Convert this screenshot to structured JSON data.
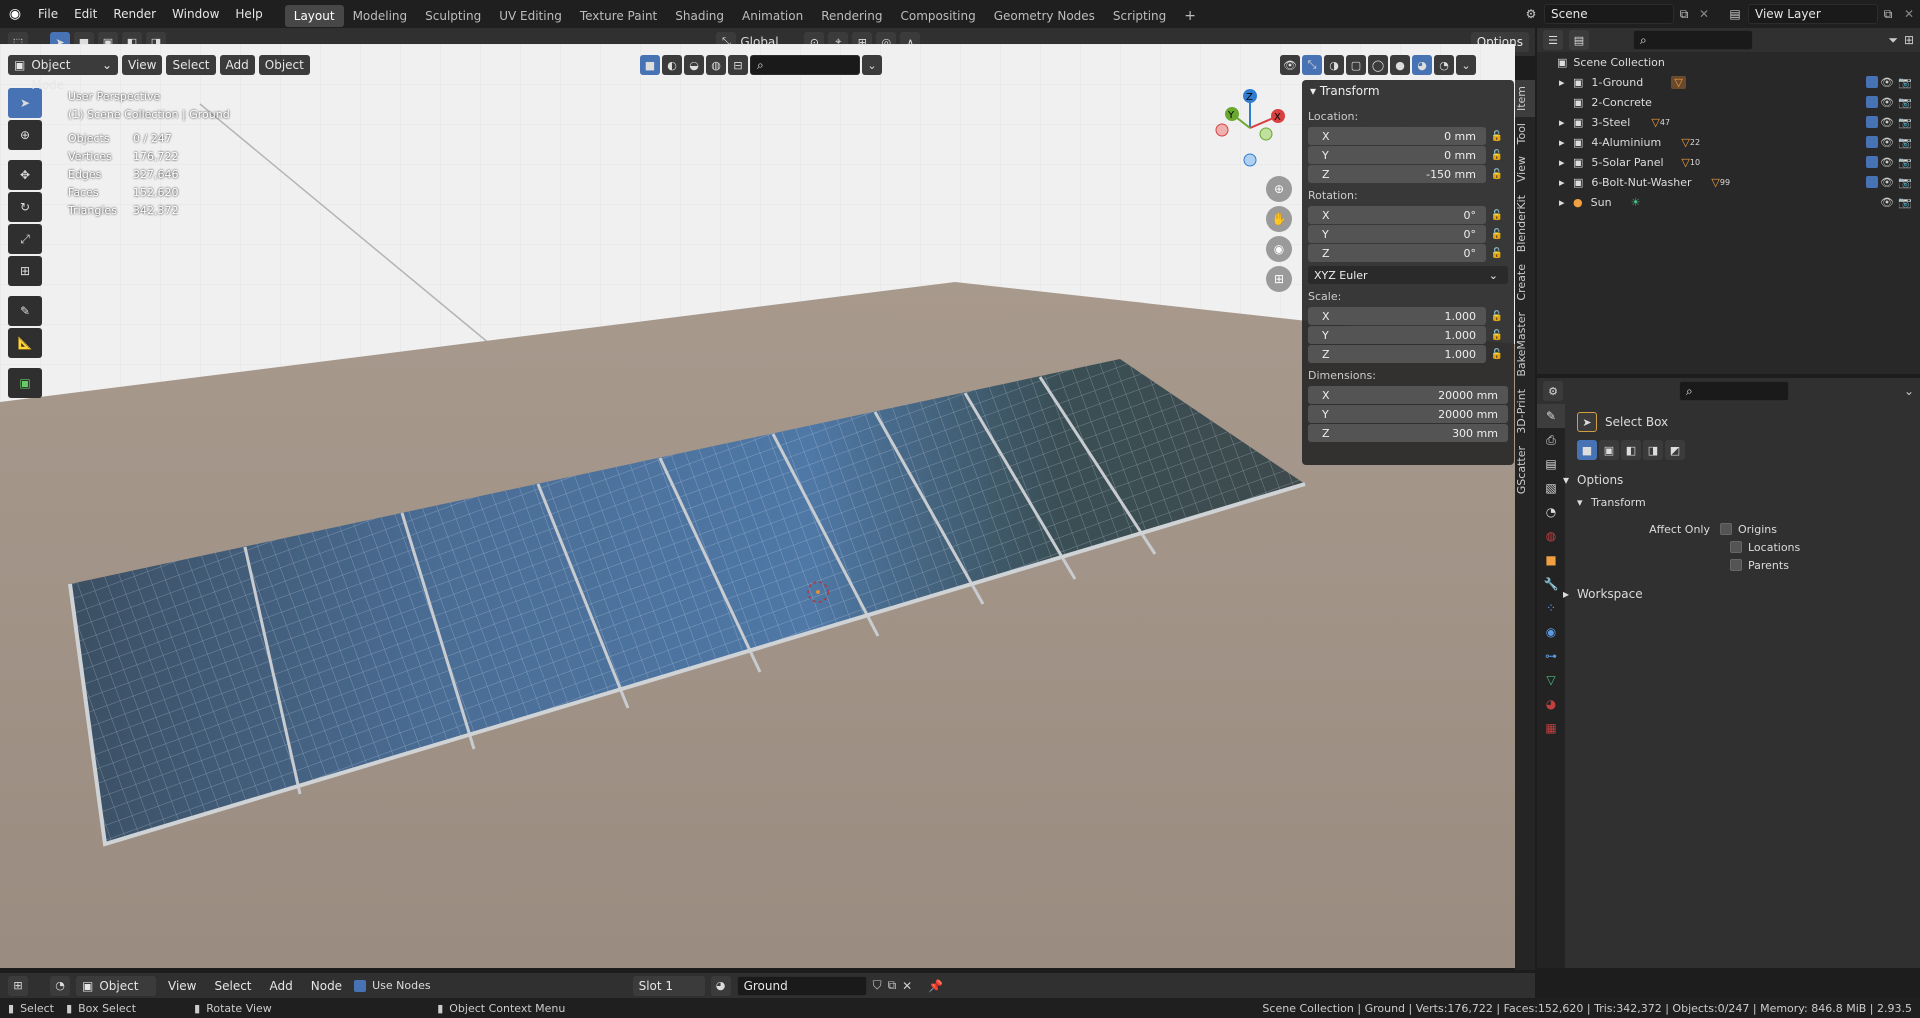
{
  "topbar": {
    "menus": [
      "File",
      "Edit",
      "Render",
      "Window",
      "Help"
    ],
    "workspaces": [
      "Layout",
      "Modeling",
      "Sculpting",
      "UV Editing",
      "Texture Paint",
      "Shading",
      "Animation",
      "Rendering",
      "Compositing",
      "Geometry Nodes",
      "Scripting"
    ],
    "active_workspace": "Layout",
    "scene": "Scene",
    "view_layer": "View Layer"
  },
  "viewport_header": {
    "mode": "Object Mode",
    "menus": [
      "View",
      "Select",
      "Add",
      "Object"
    ],
    "orientation": "Global",
    "options": "Options"
  },
  "overlay_text": {
    "perspective": "User Perspective",
    "collection": "(1) Scene Collection | Ground",
    "stats": [
      {
        "label": "Objects",
        "value": "0 / 247"
      },
      {
        "label": "Vertices",
        "value": "176,722"
      },
      {
        "label": "Edges",
        "value": "327,646"
      },
      {
        "label": "Faces",
        "value": "152,620"
      },
      {
        "label": "Triangles",
        "value": "342,372"
      }
    ]
  },
  "transform_panel": {
    "title": "Transform",
    "location_label": "Location:",
    "location": [
      {
        "axis": "X",
        "value": "0 mm"
      },
      {
        "axis": "Y",
        "value": "0 mm"
      },
      {
        "axis": "Z",
        "value": "-150 mm"
      }
    ],
    "rotation_label": "Rotation:",
    "rotation": [
      {
        "axis": "X",
        "value": "0°"
      },
      {
        "axis": "Y",
        "value": "0°"
      },
      {
        "axis": "Z",
        "value": "0°"
      }
    ],
    "rotation_mode": "XYZ Euler",
    "scale_label": "Scale:",
    "scale": [
      {
        "axis": "X",
        "value": "1.000"
      },
      {
        "axis": "Y",
        "value": "1.000"
      },
      {
        "axis": "Z",
        "value": "1.000"
      }
    ],
    "dimensions_label": "Dimensions:",
    "dimensions": [
      {
        "axis": "X",
        "value": "20000 mm"
      },
      {
        "axis": "Y",
        "value": "20000 mm"
      },
      {
        "axis": "Z",
        "value": "300 mm"
      }
    ]
  },
  "side_tabs": [
    "Item",
    "Tool",
    "View",
    "BlenderKit",
    "Create",
    "BakeMaster",
    "3D-Print",
    "GScatter"
  ],
  "outliner": {
    "root": "Scene Collection",
    "items": [
      {
        "name": "1-Ground",
        "badge": ""
      },
      {
        "name": "2-Concrete",
        "badge": ""
      },
      {
        "name": "3-Steel",
        "badge": "47"
      },
      {
        "name": "4-Aluminium",
        "badge": "22"
      },
      {
        "name": "5-Solar Panel",
        "badge": "10"
      },
      {
        "name": "6-Bolt-Nut-Washer",
        "badge": "99"
      },
      {
        "name": "Sun",
        "badge": ""
      }
    ]
  },
  "properties": {
    "tool": "Select Box",
    "options": "Options",
    "transform": "Transform",
    "affect_only": "Affect Only",
    "checks": [
      "Origins",
      "Locations",
      "Parents"
    ],
    "workspace": "Workspace"
  },
  "bottom_header": {
    "object": "Object",
    "menus": [
      "View",
      "Select",
      "Add",
      "Node"
    ],
    "use_nodes": "Use Nodes",
    "slot": "Slot 1",
    "material": "Ground"
  },
  "statusbar": {
    "select": "Select",
    "box_select": "Box Select",
    "rotate": "Rotate View",
    "context": "Object Context Menu",
    "info": "Scene Collection | Ground | Verts:176,722 | Faces:152,620 | Tris:342,372 | Objects:0/247 | Memory: 846.8 MiB | 2.93.5"
  },
  "colors": {
    "accent": "#4772b3",
    "header": "#303030",
    "bg": "#1d1d1d"
  }
}
